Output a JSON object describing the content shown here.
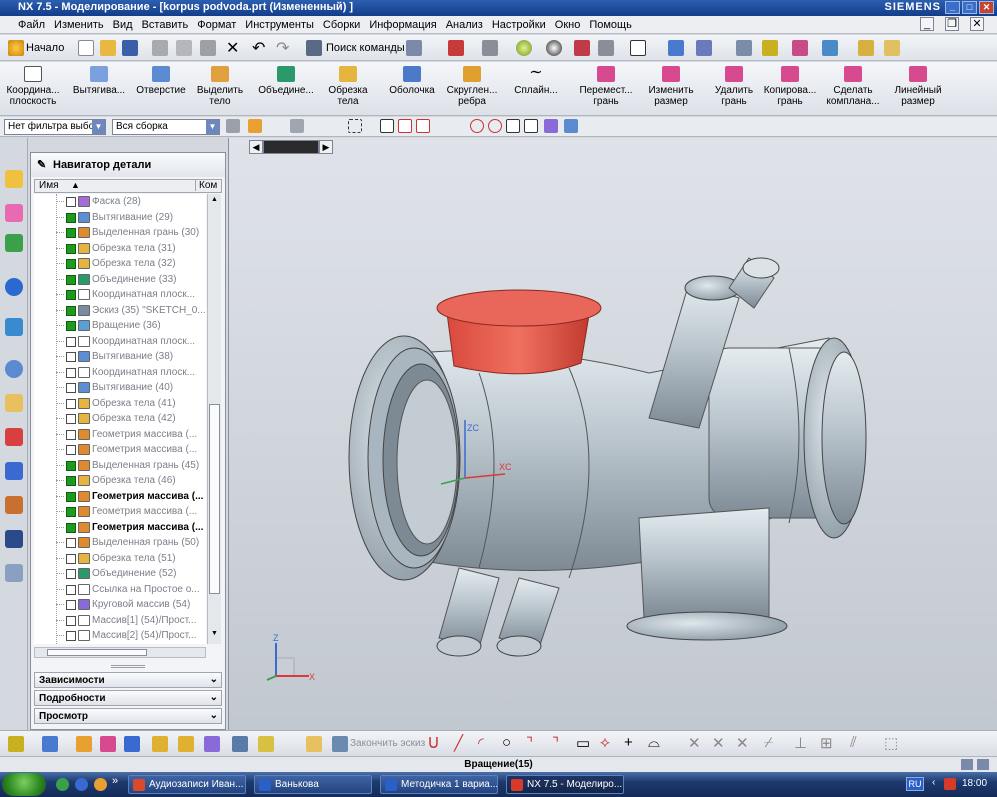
{
  "window": {
    "title": "NX 7.5 - Моделирование - [korpus podvoda.prt (Измененный) ]",
    "brand": "SIEMENS"
  },
  "menu": [
    "Файл",
    "Изменить",
    "Вид",
    "Вставить",
    "Формат",
    "Инструменты",
    "Сборки",
    "Информация",
    "Анализ",
    "Настройки",
    "Окно",
    "Помощь"
  ],
  "toolbar_standard": {
    "start_label": "Начало",
    "command_finder": "Поиск команды"
  },
  "toolbar_features": [
    {
      "label1": "Координа...",
      "label2": "плоскость",
      "icon": "datum-plane-icon"
    },
    {
      "label1": "Вытягива...",
      "label2": "",
      "icon": "extrude-icon"
    },
    {
      "label1": "Отверстие",
      "label2": "",
      "icon": "hole-icon"
    },
    {
      "label1": "Выделить",
      "label2": "тело",
      "icon": "extract-body-icon"
    },
    {
      "label1": "Объедине...",
      "label2": "",
      "icon": "unite-icon"
    },
    {
      "label1": "Обрезка",
      "label2": "тела",
      "icon": "trim-body-icon"
    },
    {
      "label1": "Оболочка",
      "label2": "",
      "icon": "shell-icon"
    },
    {
      "label1": "Скруглен...",
      "label2": "ребра",
      "icon": "edge-blend-icon"
    },
    {
      "label1": "Сплайн...",
      "label2": "",
      "icon": "spline-icon"
    },
    {
      "label1": "Перемест...",
      "label2": "грань",
      "icon": "move-face-icon"
    },
    {
      "label1": "Изменить",
      "label2": "размер",
      "icon": "resize-icon"
    },
    {
      "label1": "Удалить",
      "label2": "грань",
      "icon": "delete-face-icon"
    },
    {
      "label1": "Копирова...",
      "label2": "грань",
      "icon": "copy-face-icon"
    },
    {
      "label1": "Сделать",
      "label2": "компланa...",
      "icon": "make-coplanar-icon"
    },
    {
      "label1": "Линейный",
      "label2": "размер",
      "icon": "linear-dimension-icon"
    }
  ],
  "selection_bar": {
    "filter_value": "Нет фильтра выбор",
    "scope_value": "Вся сборка"
  },
  "navigator": {
    "title": "Навигатор детали",
    "col_name": "Имя",
    "col_comment": "Ком",
    "rows": [
      {
        "label": "Фаска (28)",
        "checked": false,
        "style": "grey",
        "color": "#a46ad8"
      },
      {
        "label": "Вытягивание (29)",
        "checked": true,
        "style": "grey",
        "color": "#5a8fd6"
      },
      {
        "label": "Выделенная грань (30)",
        "checked": true,
        "style": "grey",
        "color": "#e08a30"
      },
      {
        "label": "Обрезка тела (31)",
        "checked": true,
        "style": "grey",
        "color": "#e6b540"
      },
      {
        "label": "Обрезка тела (32)",
        "checked": true,
        "style": "grey",
        "color": "#e6b540"
      },
      {
        "label": "Объединение (33)",
        "checked": true,
        "style": "grey",
        "color": "#2a9a6a"
      },
      {
        "label": "Координатная плоск...",
        "checked": true,
        "style": "grey",
        "color": "#ffffff"
      },
      {
        "label": "Эскиз (35) \"SKETCH_0...",
        "checked": true,
        "style": "grey",
        "color": "#7a8aa0"
      },
      {
        "label": "Вращение (36)",
        "checked": true,
        "style": "grey",
        "color": "#5aa0d8"
      },
      {
        "label": "Координатная плоск...",
        "checked": false,
        "style": "grey",
        "color": "#ffffff"
      },
      {
        "label": "Вытягивание (38)",
        "checked": false,
        "style": "grey",
        "color": "#5a8fd6"
      },
      {
        "label": "Координатная плоск...",
        "checked": false,
        "style": "grey",
        "color": "#ffffff"
      },
      {
        "label": "Вытягивание (40)",
        "checked": false,
        "style": "grey",
        "color": "#5a8fd6"
      },
      {
        "label": "Обрезка тела (41)",
        "checked": false,
        "style": "grey",
        "color": "#e6b540"
      },
      {
        "label": "Обрезка тела (42)",
        "checked": false,
        "style": "grey",
        "color": "#e6b540"
      },
      {
        "label": "Геометрия массива (...",
        "checked": false,
        "style": "grey",
        "color": "#e08a30"
      },
      {
        "label": "Геометрия массива (...",
        "checked": false,
        "style": "grey",
        "color": "#e08a30"
      },
      {
        "label": "Выделенная грань (45)",
        "checked": true,
        "style": "grey",
        "color": "#e08a30"
      },
      {
        "label": "Обрезка тела (46)",
        "checked": true,
        "style": "grey",
        "color": "#e6b540"
      },
      {
        "label": "Геометрия массива (...",
        "checked": true,
        "style": "dark",
        "color": "#e08a30"
      },
      {
        "label": "Геометрия массива (...",
        "checked": true,
        "style": "grey",
        "color": "#e08a30"
      },
      {
        "label": "Геометрия массива (...",
        "checked": true,
        "style": "dark",
        "color": "#e08a30"
      },
      {
        "label": "Выделенная грань (50)",
        "checked": false,
        "style": "grey",
        "color": "#e08a30"
      },
      {
        "label": "Обрезка тела (51)",
        "checked": false,
        "style": "grey",
        "color": "#e6b540"
      },
      {
        "label": "Объединение (52)",
        "checked": false,
        "style": "grey",
        "color": "#2a9a6a"
      },
      {
        "label": "Ссылка на Простое о...",
        "checked": false,
        "style": "grey",
        "color": "#ffffff"
      },
      {
        "label": "Круговой массив (54)",
        "checked": false,
        "style": "grey",
        "color": "#8a6ad8"
      },
      {
        "label": "Массив[1] (54)/Прост...",
        "checked": false,
        "style": "grey",
        "color": "#ffffff"
      },
      {
        "label": "Массив[2] (54)/Прост...",
        "checked": false,
        "style": "grey",
        "color": "#ffffff"
      }
    ],
    "sections": [
      "Зависимости",
      "Подробности",
      "Просмотр"
    ]
  },
  "viewport": {
    "axis_zc": "ZC",
    "axis_xc": "XC",
    "triad_z": "Z",
    "triad_x": "X",
    "body_color": "#b9c4cc",
    "highlight_color": "#e05a4e"
  },
  "bottom_toolbar": {
    "finish_sketch": "Закончить эскиз"
  },
  "status": {
    "text": "Вращение(15)"
  },
  "taskbar": {
    "tasks": [
      {
        "label": "Аудиозаписи Иван...",
        "color": "#d94a2a"
      },
      {
        "label": "Ванькова",
        "color": "#2a5fc8"
      },
      {
        "label": "Методичка 1 вариа...",
        "color": "#2a5fc8"
      },
      {
        "label": "NX 7.5 - Моделиро...",
        "color": "#d83a2a"
      }
    ],
    "lang": "RU",
    "time": "18:00"
  }
}
